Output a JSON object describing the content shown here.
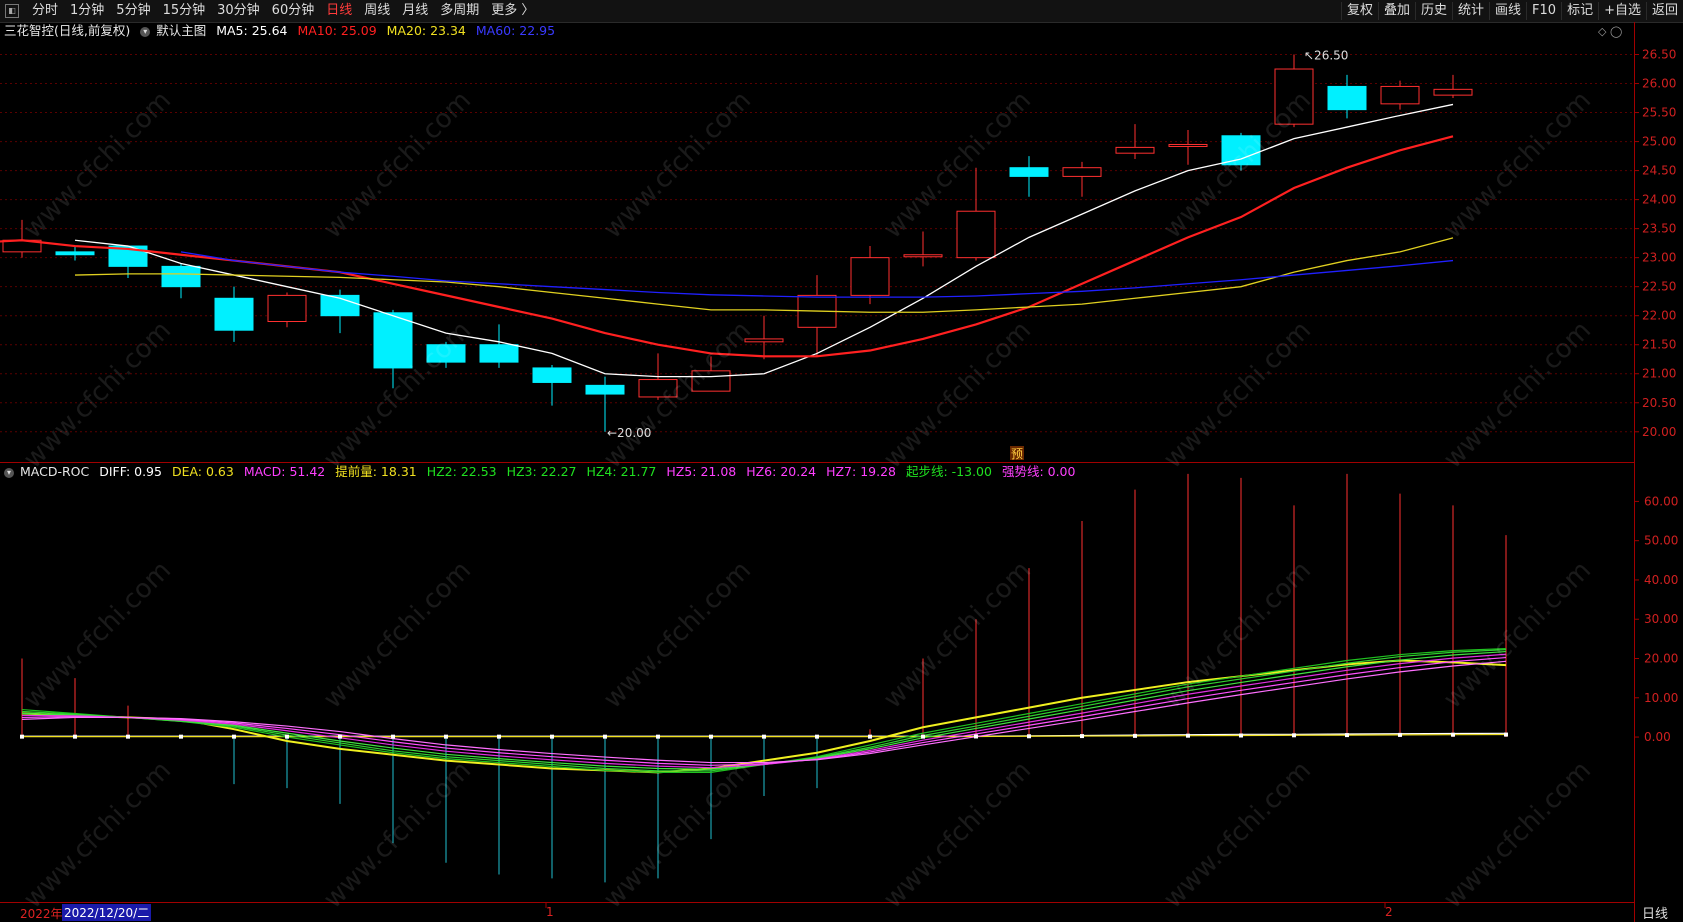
{
  "toolbar": {
    "periods": [
      "分时",
      "1分钟",
      "5分钟",
      "15分钟",
      "30分钟",
      "60分钟",
      "日线",
      "周线",
      "月线",
      "多周期",
      "更多 〉"
    ],
    "active_period": "日线",
    "right_buttons": [
      "复权",
      "叠加",
      "历史",
      "统计",
      "画线",
      "F10",
      "标记",
      "+自选",
      "返回"
    ]
  },
  "main_header": {
    "stock": "三花智控(日线,前复权)",
    "template": "默认主图",
    "ma5": "MA5: 25.64",
    "ma10": "MA10: 25.09",
    "ma20": "MA20: 23.34",
    "ma60": "MA60: 22.95",
    "colors": {
      "ma5": "#ffffff",
      "ma10": "#ff2020",
      "ma20": "#f0e020",
      "ma60": "#2020ff"
    }
  },
  "indicator_header": {
    "name": "MACD-ROC",
    "diff": "DIFF: 0.95",
    "dea": "DEA: 0.63",
    "macd": "MACD: 51.42",
    "tiqian": "提前量: 18.31",
    "hz2": "HZ2: 22.53",
    "hz3": "HZ3: 22.27",
    "hz4": "HZ4: 21.77",
    "hz5": "HZ5: 21.08",
    "hz6": "HZ6: 20.24",
    "hz7": "HZ7: 19.28",
    "qibu": "起步线: -13.00",
    "qiangshi": "强势线: 0.00"
  },
  "annotations": {
    "high": "26.50",
    "low": "20.00",
    "marker": "预"
  },
  "bottom": {
    "year": "2022年",
    "cursor_date": "2022/12/20/二",
    "month1": "1",
    "month2": "2",
    "period": "日线"
  },
  "watermark": "www.cfchi.com",
  "chart_data": [
    {
      "type": "candlestick",
      "title": "三花智控(日线,前复权)",
      "ylim": [
        19.6,
        26.75
      ],
      "yticks": [
        "26.50",
        "26.00",
        "25.50",
        "25.00",
        "24.50",
        "24.00",
        "23.50",
        "23.00",
        "22.50",
        "22.00",
        "21.50",
        "21.00",
        "20.50",
        "20.00"
      ],
      "candles": [
        {
          "o": 23.1,
          "c": 23.3,
          "h": 23.65,
          "l": 23.0
        },
        {
          "o": 23.1,
          "c": 23.05,
          "h": 23.2,
          "l": 22.95
        },
        {
          "o": 23.2,
          "c": 22.85,
          "h": 23.2,
          "l": 22.65
        },
        {
          "o": 22.85,
          "c": 22.5,
          "h": 22.9,
          "l": 22.3
        },
        {
          "o": 22.3,
          "c": 21.75,
          "h": 22.5,
          "l": 21.55
        },
        {
          "o": 21.9,
          "c": 22.35,
          "h": 22.4,
          "l": 21.8
        },
        {
          "o": 22.35,
          "c": 22.0,
          "h": 22.45,
          "l": 21.7
        },
        {
          "o": 22.05,
          "c": 21.1,
          "h": 22.1,
          "l": 20.75
        },
        {
          "o": 21.5,
          "c": 21.2,
          "h": 21.55,
          "l": 21.1
        },
        {
          "o": 21.5,
          "c": 21.2,
          "h": 21.85,
          "l": 21.1
        },
        {
          "o": 21.1,
          "c": 20.85,
          "h": 21.15,
          "l": 20.45
        },
        {
          "o": 20.8,
          "c": 20.65,
          "h": 20.95,
          "l": 20.0
        },
        {
          "o": 20.6,
          "c": 20.9,
          "h": 21.35,
          "l": 20.55
        },
        {
          "o": 20.7,
          "c": 21.05,
          "h": 21.3,
          "l": 20.7
        },
        {
          "o": 21.55,
          "c": 21.6,
          "h": 22.0,
          "l": 21.25
        },
        {
          "o": 21.8,
          "c": 22.35,
          "h": 22.7,
          "l": 21.3
        },
        {
          "o": 22.35,
          "c": 23.0,
          "h": 23.2,
          "l": 22.2
        },
        {
          "o": 23.05,
          "c": 23.05,
          "h": 23.45,
          "l": 22.85
        },
        {
          "o": 23.0,
          "c": 23.8,
          "h": 24.55,
          "l": 22.95
        },
        {
          "o": 24.55,
          "c": 24.4,
          "h": 24.75,
          "l": 24.05
        },
        {
          "o": 24.4,
          "c": 24.55,
          "h": 24.65,
          "l": 24.05
        },
        {
          "o": 24.8,
          "c": 24.9,
          "h": 25.3,
          "l": 24.7
        },
        {
          "o": 24.95,
          "c": 24.95,
          "h": 25.2,
          "l": 24.6
        },
        {
          "o": 25.1,
          "c": 24.6,
          "h": 25.15,
          "l": 24.5
        },
        {
          "o": 25.3,
          "c": 26.25,
          "h": 26.5,
          "l": 25.25
        },
        {
          "o": 25.95,
          "c": 25.55,
          "h": 26.15,
          "l": 25.4
        },
        {
          "o": 25.65,
          "c": 25.95,
          "h": 26.05,
          "l": 25.55
        },
        {
          "o": 25.8,
          "c": 25.9,
          "h": 26.15,
          "l": 25.75
        }
      ],
      "series": [
        {
          "name": "MA5",
          "values": [
            null,
            null,
            23.3,
            23.2,
            22.9,
            22.7,
            22.5,
            22.3,
            22.0,
            21.7,
            21.55,
            21.35,
            21.0,
            20.95,
            20.95,
            21.0,
            21.35,
            21.8,
            22.3,
            22.85,
            23.35,
            23.75,
            24.15,
            24.5,
            24.7,
            25.05,
            25.25,
            25.45,
            25.64
          ]
        },
        {
          "name": "MA10",
          "values": [
            23.25,
            23.3,
            23.2,
            23.15,
            23.05,
            22.95,
            22.85,
            22.75,
            22.55,
            22.35,
            22.15,
            21.95,
            21.7,
            21.5,
            21.35,
            21.3,
            21.3,
            21.4,
            21.6,
            21.85,
            22.15,
            22.55,
            22.95,
            23.35,
            23.7,
            24.2,
            24.55,
            24.85,
            25.09
          ]
        },
        {
          "name": "MA20",
          "values": [
            22.7,
            22.72,
            22.72,
            22.7,
            22.68,
            22.66,
            22.62,
            22.58,
            22.5,
            22.4,
            22.3,
            22.2,
            22.1,
            22.1,
            22.08,
            22.06,
            22.06,
            22.1,
            22.15,
            22.2,
            22.3,
            22.4,
            22.5,
            22.75,
            22.95,
            23.1,
            23.34
          ]
        },
        {
          "name": "MA60",
          "values": [
            23.1,
            22.95,
            22.85,
            22.75,
            22.68,
            22.6,
            22.55,
            22.5,
            22.45,
            22.4,
            22.36,
            22.34,
            22.32,
            22.32,
            22.32,
            22.34,
            22.38,
            22.42,
            22.48,
            22.55,
            22.62,
            22.7,
            22.78,
            22.86,
            22.95
          ]
        }
      ]
    },
    {
      "type": "bar",
      "title": "MACD-ROC",
      "ylim": [
        -42,
        68
      ],
      "yticks": [
        "60.00",
        "50.00",
        "40.00",
        "30.00",
        "20.00",
        "10.00",
        "0.00"
      ],
      "macd_bars": [
        20,
        15,
        8,
        0,
        -12,
        -13,
        -17,
        -27,
        -32,
        -35,
        -36,
        -37,
        -36,
        -26,
        -15,
        -13,
        2,
        20,
        30,
        43,
        55,
        63,
        67,
        66,
        59,
        67,
        62,
        59,
        51.42
      ],
      "series": [
        {
          "name": "DIFF",
          "values": [
            0.2,
            0.2,
            0.2,
            0.2,
            0.2,
            0.2,
            0.2,
            0.2,
            0.2,
            0.2,
            0.2,
            0.2,
            0.2,
            0.2,
            0.2,
            0.2,
            0.2,
            0.2,
            0.2,
            0.3,
            0.4,
            0.5,
            0.6,
            0.7,
            0.7,
            0.8,
            0.85,
            0.9,
            0.95
          ]
        },
        {
          "name": "DEA",
          "values": [
            0.1,
            0.1,
            0.1,
            0.1,
            0.1,
            0.1,
            0.1,
            0.1,
            0.1,
            0.1,
            0.1,
            0.1,
            0.1,
            0.1,
            0.1,
            0.1,
            0.1,
            0.1,
            0.15,
            0.2,
            0.25,
            0.3,
            0.35,
            0.4,
            0.45,
            0.5,
            0.55,
            0.6,
            0.63
          ]
        },
        {
          "name": "提前量",
          "values": [
            6,
            5.5,
            5,
            4.5,
            2,
            -1,
            -3,
            -4.5,
            -6,
            -7,
            -8,
            -8.5,
            -9,
            -8,
            -6,
            -4,
            -1,
            2.5,
            5,
            7.5,
            10,
            12,
            14,
            15.5,
            17,
            18.5,
            19.5,
            19,
            18.31
          ]
        },
        {
          "name": "HZ2",
          "values": [
            7,
            6,
            5,
            4,
            2.5,
            0,
            -2,
            -4,
            -5.5,
            -6.5,
            -7.5,
            -8.5,
            -9,
            -9,
            -7,
            -5,
            -2,
            1,
            3.5,
            6,
            8.5,
            11,
            13.5,
            15.5,
            17.5,
            19.5,
            21,
            22,
            22.53
          ]
        },
        {
          "name": "HZ3",
          "values": [
            6.5,
            5.8,
            5,
            4,
            2.8,
            0.5,
            -1.5,
            -3.5,
            -5,
            -6,
            -7,
            -8,
            -8.6,
            -8.6,
            -7,
            -5.2,
            -2.6,
            0.4,
            2.8,
            5.3,
            7.8,
            10.3,
            12.8,
            14.8,
            16.8,
            18.8,
            20.5,
            21.6,
            22.27
          ]
        },
        {
          "name": "HZ4",
          "values": [
            6,
            5.6,
            5,
            4.1,
            3,
            1,
            -1,
            -2.8,
            -4.4,
            -5.5,
            -6.5,
            -7.4,
            -8,
            -8.2,
            -7,
            -5.4,
            -3,
            -0.2,
            2.2,
            4.6,
            7,
            9.4,
            11.8,
            13.9,
            15.9,
            17.9,
            19.6,
            20.9,
            21.77
          ]
        },
        {
          "name": "HZ5",
          "values": [
            5.5,
            5.4,
            5,
            4.3,
            3.3,
            1.6,
            -0.2,
            -2,
            -3.6,
            -4.8,
            -5.8,
            -6.7,
            -7.4,
            -7.8,
            -7,
            -5.6,
            -3.4,
            -0.8,
            1.5,
            3.8,
            6.1,
            8.5,
            10.9,
            13,
            15,
            17,
            18.7,
            20.1,
            21.08
          ]
        },
        {
          "name": "HZ6",
          "values": [
            5,
            5.2,
            5,
            4.5,
            3.6,
            2.2,
            0.6,
            -1.2,
            -2.8,
            -4,
            -5,
            -5.9,
            -6.7,
            -7.2,
            -6.8,
            -5.7,
            -3.8,
            -1.4,
            0.8,
            3,
            5.2,
            7.5,
            9.8,
            11.9,
            13.9,
            15.9,
            17.7,
            19.2,
            20.24
          ]
        },
        {
          "name": "HZ7",
          "values": [
            4.5,
            5,
            5,
            4.7,
            3.9,
            2.8,
            1.4,
            -0.4,
            -2,
            -3.2,
            -4.2,
            -5.1,
            -5.9,
            -6.5,
            -6.5,
            -5.8,
            -4.2,
            -2,
            0.1,
            2.2,
            4.3,
            6.5,
            8.7,
            10.8,
            12.8,
            14.8,
            16.6,
            18.1,
            19.28
          ]
        }
      ]
    }
  ]
}
